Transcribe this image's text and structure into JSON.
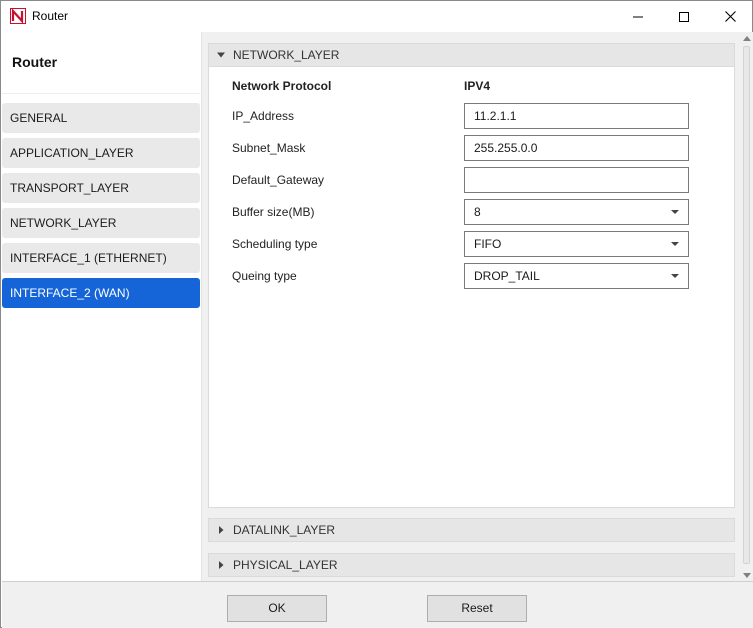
{
  "window": {
    "title": "Router"
  },
  "left_panel": {
    "title": "Router",
    "items": [
      {
        "label": "GENERAL",
        "active": false
      },
      {
        "label": "APPLICATION_LAYER",
        "active": false
      },
      {
        "label": "TRANSPORT_LAYER",
        "active": false
      },
      {
        "label": "NETWORK_LAYER",
        "active": false
      },
      {
        "label": "INTERFACE_1 (ETHERNET)",
        "active": false
      },
      {
        "label": "INTERFACE_2 (WAN)",
        "active": true
      }
    ]
  },
  "sections": {
    "network_layer": {
      "label": "NETWORK_LAYER",
      "expanded": true
    },
    "datalink_layer": {
      "label": "DATALINK_LAYER",
      "expanded": false
    },
    "physical_layer": {
      "label": "PHYSICAL_LAYER",
      "expanded": false
    }
  },
  "form": {
    "protocol_label": "Network Protocol",
    "protocol_value": "IPV4",
    "ip_address": {
      "label": "IP_Address",
      "value": "11.2.1.1"
    },
    "subnet_mask": {
      "label": "Subnet_Mask",
      "value": "255.255.0.0"
    },
    "default_gateway": {
      "label": "Default_Gateway",
      "value": ""
    },
    "buffer_size": {
      "label": "Buffer size(MB)",
      "value": "8"
    },
    "scheduling_type": {
      "label": "Scheduling type",
      "value": "FIFO"
    },
    "queing_type": {
      "label": "Queing type",
      "value": "DROP_TAIL"
    }
  },
  "buttons": {
    "ok": "OK",
    "reset": "Reset"
  },
  "colors": {
    "accent": "#1565d8",
    "logo_red": "#c8102e"
  },
  "icons": [
    "app-logo-icon",
    "minimize-icon",
    "maximize-icon",
    "close-icon",
    "caret-down-icon",
    "caret-right-icon",
    "dropdown-arrow-icon"
  ]
}
